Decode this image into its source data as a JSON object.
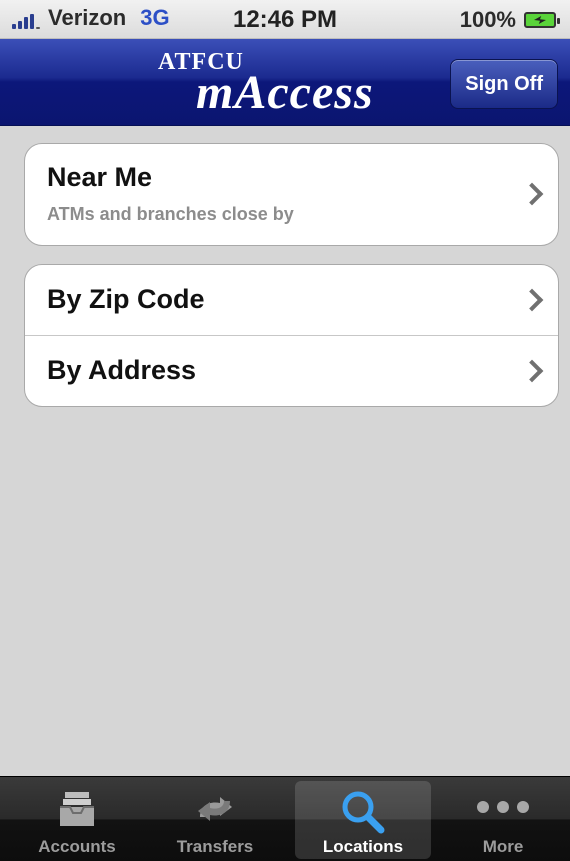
{
  "status_bar": {
    "carrier": "Verizon",
    "network": "3G",
    "time": "12:46 PM",
    "battery": "100%"
  },
  "header": {
    "logo_top": "ATFCU",
    "logo_main": "mAccess",
    "sign_off_label": "Sign Off"
  },
  "groups": [
    {
      "rows": [
        {
          "title": "Near Me",
          "subtitle": "ATMs and branches close by"
        }
      ]
    },
    {
      "rows": [
        {
          "title": "By Zip Code"
        },
        {
          "title": "By Address"
        }
      ]
    }
  ],
  "tabbar": {
    "tabs": [
      {
        "label": "Accounts",
        "icon": "inbox-tray-icon",
        "active": false
      },
      {
        "label": "Transfers",
        "icon": "transfer-arrows-icon",
        "active": false
      },
      {
        "label": "Locations",
        "icon": "magnifier-icon",
        "active": true
      },
      {
        "label": "More",
        "icon": "more-dots-icon",
        "active": false
      }
    ]
  },
  "colors": {
    "header_blue": "#0c177a",
    "network_blue": "#2c4fc6",
    "battery_green": "#5ad43a",
    "active_icon_blue": "#3aa0f0"
  }
}
